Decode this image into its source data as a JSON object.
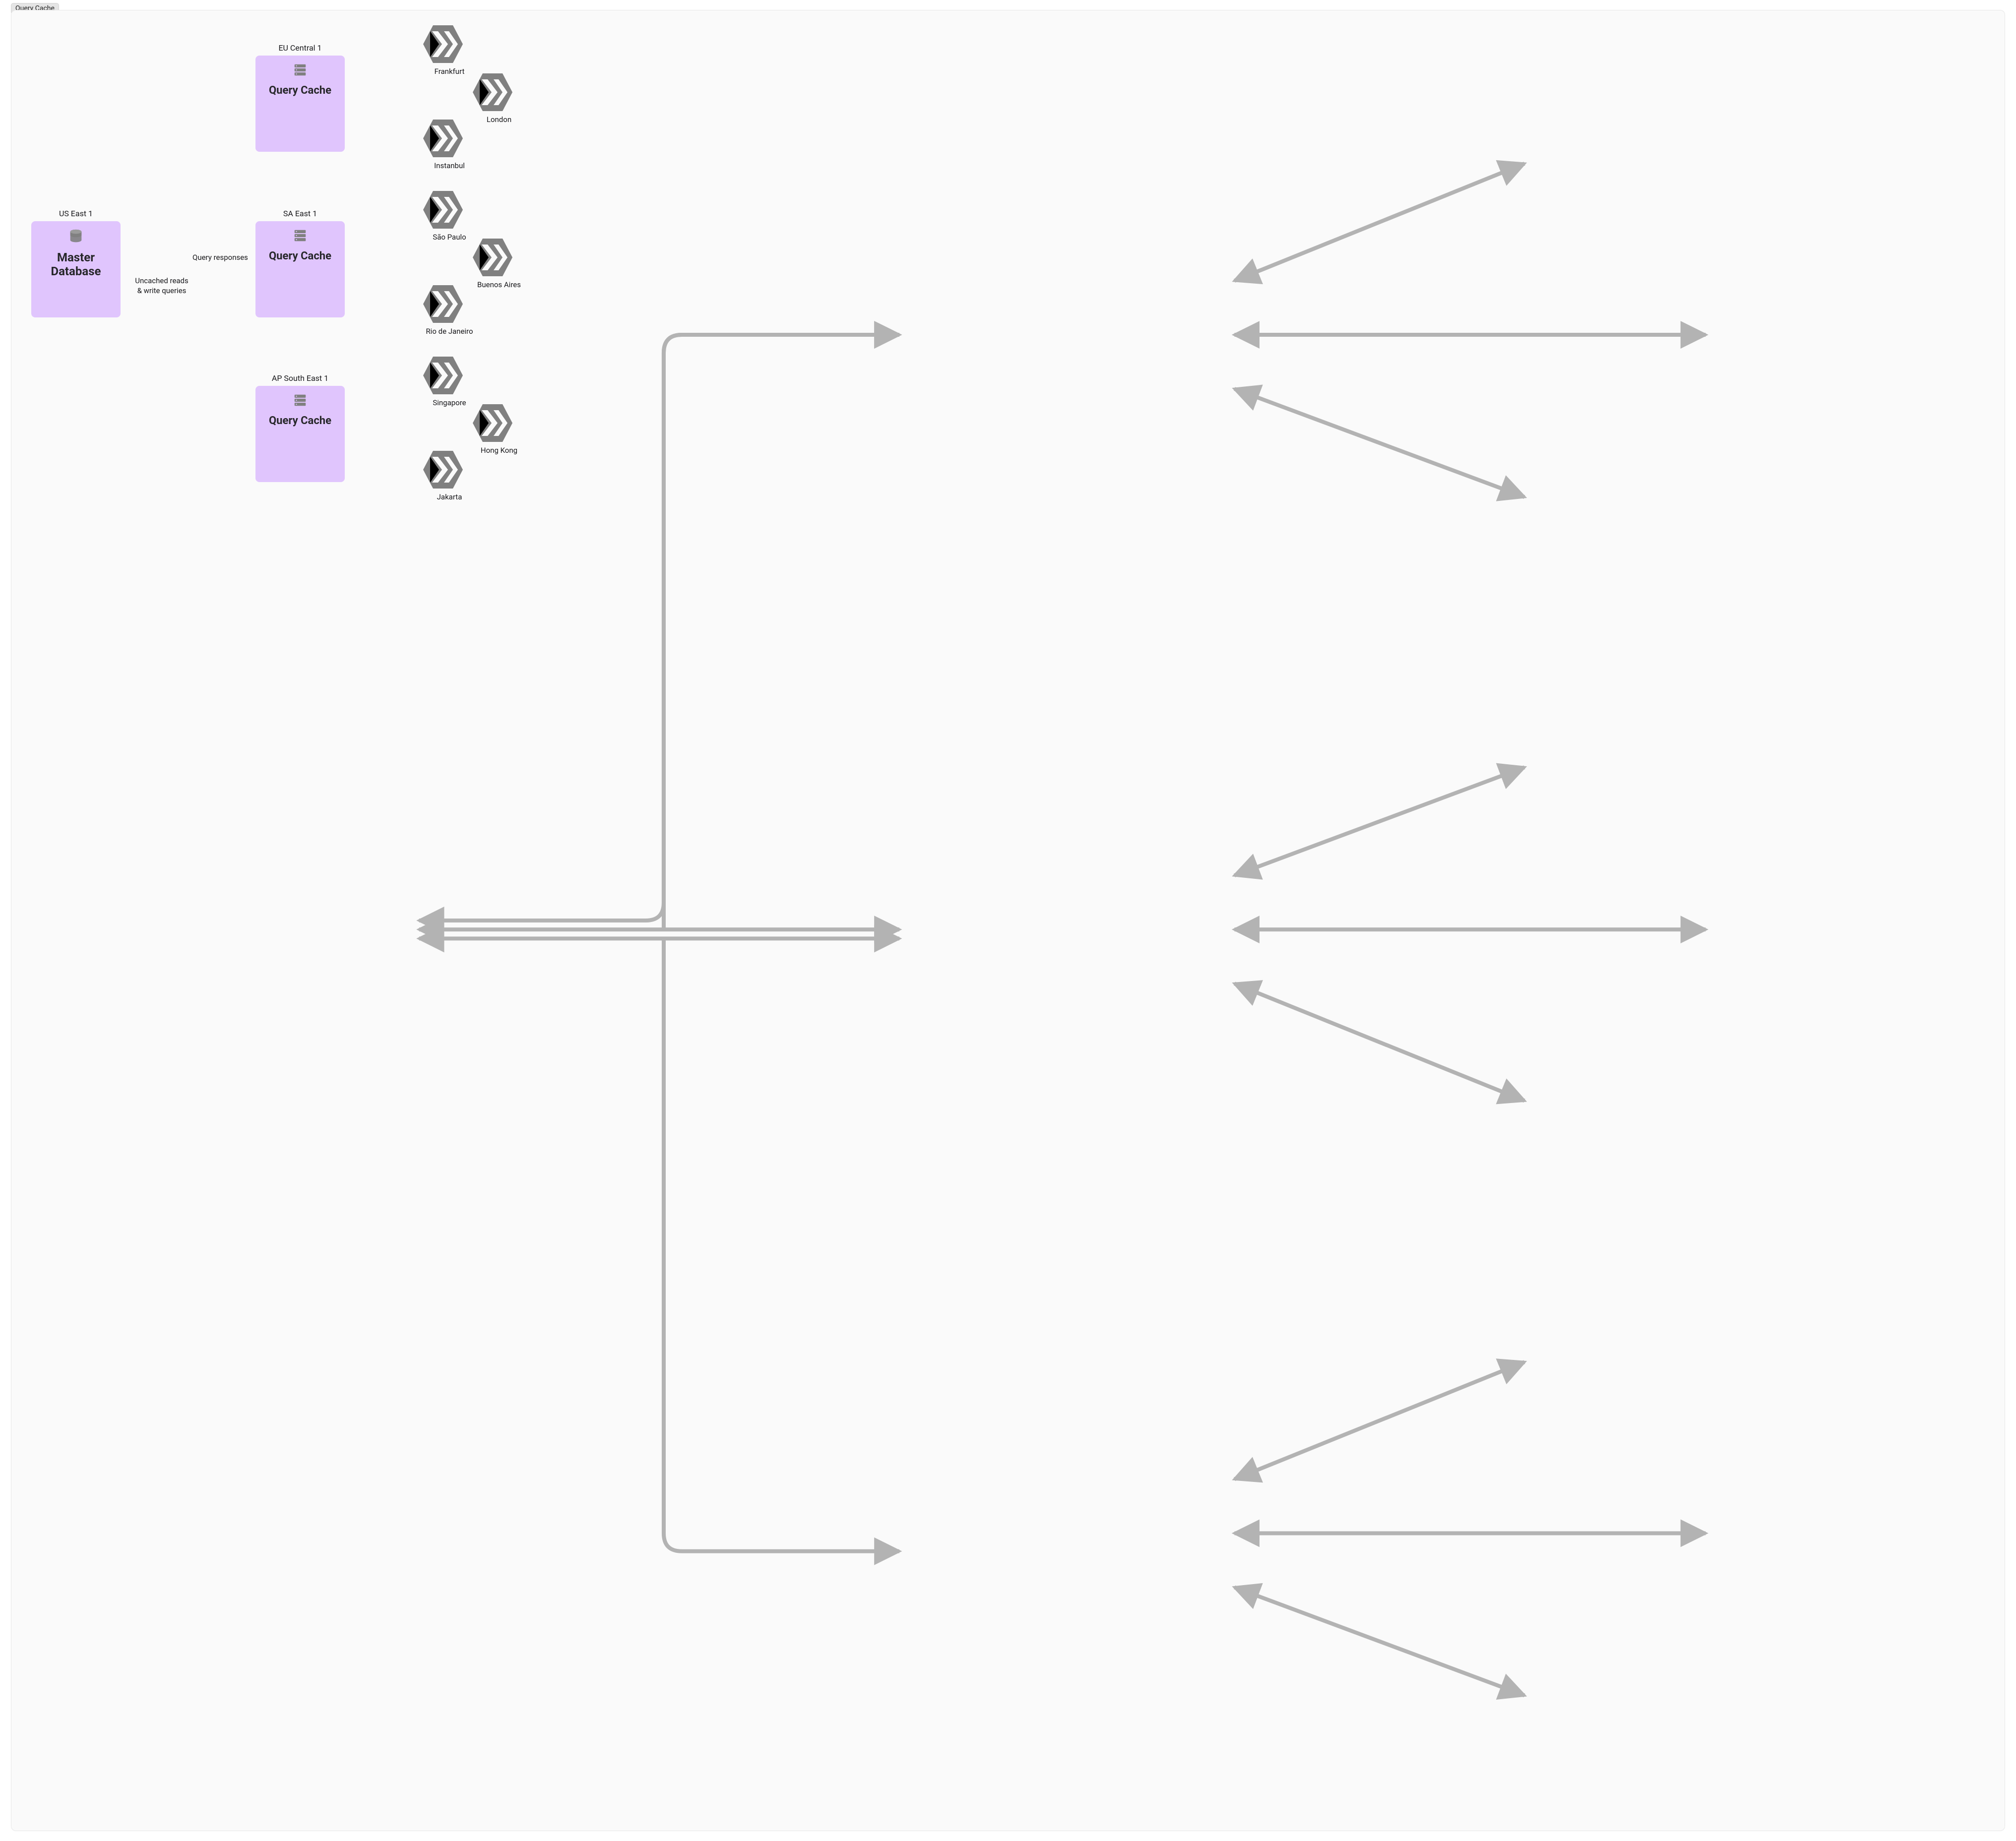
{
  "tag": "Query Cache",
  "master": {
    "region": "US East 1",
    "label": "Master\nDatabase"
  },
  "caches": [
    {
      "region": "EU Central 1",
      "label": "Query Cache"
    },
    {
      "region": "SA East 1",
      "label": "Query Cache"
    },
    {
      "region": "AP South East 1",
      "label": "Query Cache"
    }
  ],
  "apps": {
    "eu": [
      "Frankfurt",
      "London",
      "Instanbul"
    ],
    "sa": [
      "São Paulo",
      "Buenos Aires",
      "Rio de Janeiro"
    ],
    "ap": [
      "Singapore",
      "Hong Kong",
      "Jakarta"
    ]
  },
  "edges": {
    "top": "Query responses",
    "bottom": "Uncached reads\n& write queries"
  },
  "icons": {
    "db": "database-icon",
    "srv": "server-icon",
    "app": "app-hex-icon"
  },
  "colors": {
    "box": "#e0c5fd",
    "arrow": "#b3b3b3",
    "icon": "#808080",
    "panel": "#fafafa",
    "tag": "#e5e5e5"
  }
}
